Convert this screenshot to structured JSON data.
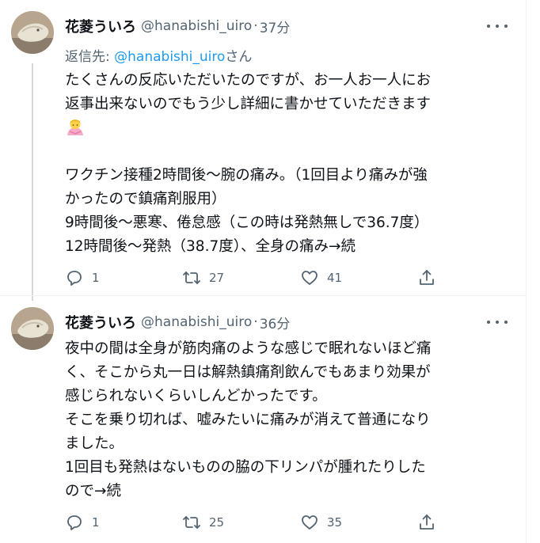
{
  "tweets": [
    {
      "author": "花菱ういろ",
      "handle": "@hanabishi_uiro",
      "time": "37分",
      "reply_prefix": "返信先: ",
      "reply_handle": "@hanabishi_uiro",
      "reply_suffix": "さん",
      "lines": [
        "たくさんの反応いただいたのですが、お一人お一人にお",
        "返事出来ないのでもう少し詳細に書かせていただきます",
        "",
        "",
        "ワクチン接種2時間後〜腕の痛み。（1回目より痛みが強",
        "かったので鎮痛剤服用）",
        "9時間後〜悪寒、倦怠感（この時は発熱無しで36.7度）",
        "12時間後〜発熱（38.7度）、全身の痛み→続"
      ],
      "emoji": "person-bowing",
      "replies": "1",
      "retweets": "27",
      "likes": "41"
    },
    {
      "author": "花菱ういろ",
      "handle": "@hanabishi_uiro",
      "time": "36分",
      "lines": [
        "夜中の間は全身が筋肉痛のような感じで眠れないほど痛",
        "く、そこから丸一日は解熱鎮痛剤飲んでもあまり効果が",
        "感じられないくらいしんどかったです。",
        "そこを乗り切れば、嘘みたいに痛みが消えて普通になり",
        "ました。",
        "1回目も発熱はないものの脇の下リンパが腫れたりした",
        "ので→続"
      ],
      "replies": "1",
      "retweets": "25",
      "likes": "35"
    }
  ],
  "colors": {
    "text": "#0f1419",
    "secondary": "#536471",
    "link": "#1d9bf0",
    "border": "#eff3f4",
    "thread_line": "#cfd9de"
  }
}
